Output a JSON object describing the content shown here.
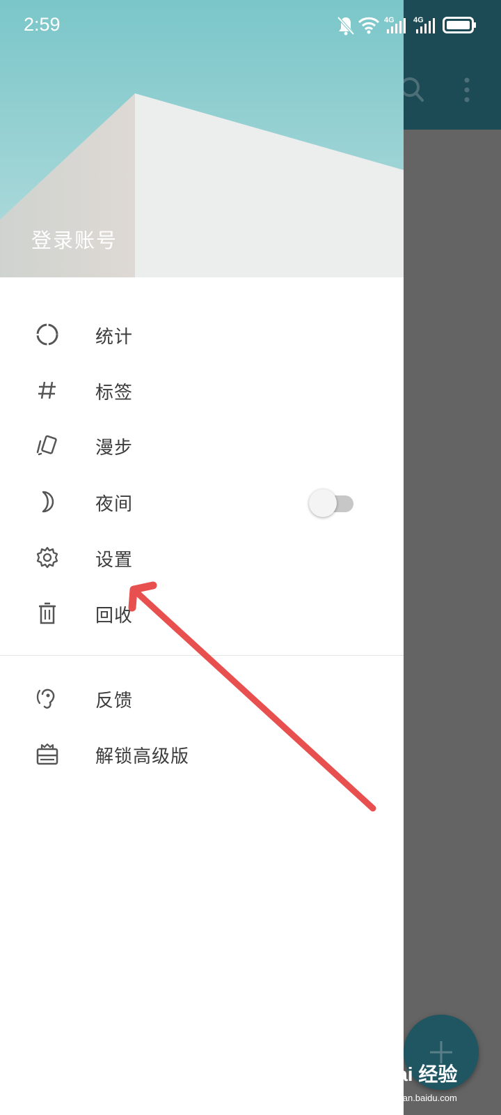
{
  "status_bar": {
    "time": "2:59",
    "icons": [
      "mute-bell-icon",
      "wifi-icon",
      "signal-4g-icon",
      "signal-4g-icon",
      "battery-icon"
    ],
    "network_label_1": "4G",
    "network_label_2": "4G"
  },
  "drawer": {
    "header": {
      "login_label": "登录账号"
    },
    "menu": [
      {
        "icon": "stats-icon",
        "label": "统计"
      },
      {
        "icon": "hashtag-icon",
        "label": "标签"
      },
      {
        "icon": "cards-icon",
        "label": "漫步"
      },
      {
        "icon": "moon-icon",
        "label": "夜间",
        "toggle": false
      },
      {
        "icon": "gear-icon",
        "label": "设置"
      },
      {
        "icon": "trash-icon",
        "label": "回收"
      }
    ],
    "secondary_menu": [
      {
        "icon": "feedback-ear-icon",
        "label": "反馈"
      },
      {
        "icon": "gift-icon",
        "label": "解锁高级版"
      }
    ]
  },
  "background_app": {
    "toolbar_icons": [
      "search-icon",
      "more-vert-icon"
    ],
    "fab_icon": "plus-icon"
  },
  "watermark": {
    "text": "Bai 经验",
    "url_text": "jingyan.baidu.com"
  },
  "colors": {
    "annotation_arrow": "#e8504f",
    "toolbar": "#1c4b55",
    "fab": "#1f5662",
    "scrim": "#646464",
    "header_sky": "#7ec9cb"
  }
}
